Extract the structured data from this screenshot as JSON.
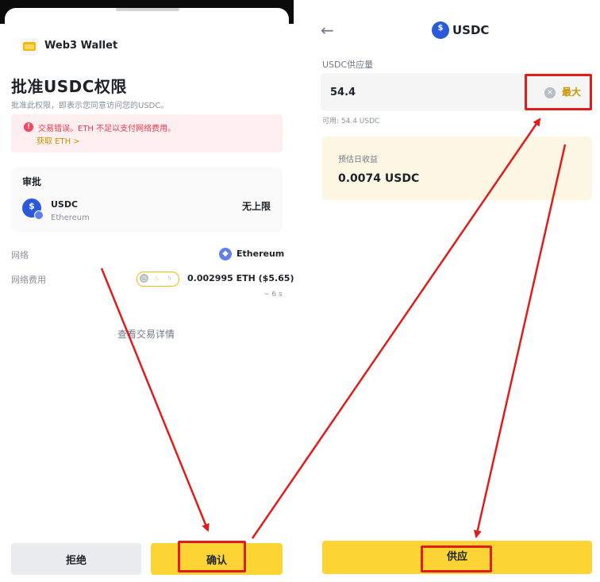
{
  "left_panel": {
    "wallet_title": "Web3 Wallet",
    "title": "批准USDC权限",
    "subtitle": "批准此权限，即表示您同意访问您的USDC。",
    "error": {
      "icon": "alert-icon",
      "message": "交易错误。ETH 不足以支付网络费用。",
      "link": "获取 ETH >"
    },
    "approve": {
      "label": "审批",
      "token": "USDC",
      "chain": "Ethereum",
      "amount": "无上限"
    },
    "network": {
      "label": "网络",
      "value": "Ethereum"
    },
    "fee": {
      "label": "网络费用",
      "value": "0.002995 ETH ($5.65)",
      "time": "~ 6 s"
    },
    "view_details": "查看交易详情",
    "reject_label": "拒绝",
    "confirm_label": "确认"
  },
  "right_panel": {
    "header_title": "USDC",
    "supply_amount_label": "USDC供应量",
    "amount_value": "54.4",
    "max_label": "最大",
    "available": "可用: 54.4 USDC",
    "est_label": "预估日收益",
    "est_value": "0.0074 USDC",
    "supply_label": "供应"
  },
  "colors": {
    "accent_yellow": "#fcd535",
    "annotation_red": "#e21b1b",
    "error_red": "#f6465d",
    "usdc_blue": "#2a5ada"
  }
}
